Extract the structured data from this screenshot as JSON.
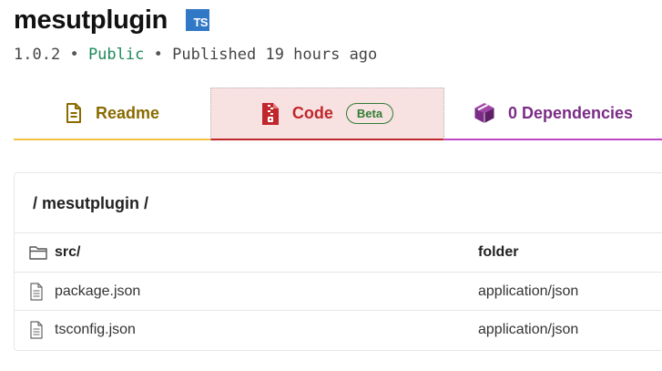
{
  "package": {
    "name": "mesutplugin",
    "ts_badge": "TS",
    "version": "1.0.2",
    "separator": "•",
    "visibility": "Public",
    "published": "Published 19 hours ago"
  },
  "tabs": [
    {
      "label": "Readme",
      "icon": "document-icon",
      "color": "#8a6b00",
      "active": false
    },
    {
      "label": "Code",
      "icon": "zip-file-icon",
      "badge": "Beta",
      "color": "#c0262b",
      "active": true
    },
    {
      "label": "0 Dependencies",
      "icon": "cube-icon",
      "color": "#7b2c86",
      "active": false
    }
  ],
  "files": {
    "breadcrumb": "/ mesutplugin /",
    "rows": [
      {
        "name": "src/",
        "type": "folder",
        "icon": "folder-icon"
      },
      {
        "name": "package.json",
        "type": "application/json",
        "icon": "file-icon"
      },
      {
        "name": "tsconfig.json",
        "type": "application/json",
        "icon": "file-icon"
      }
    ]
  },
  "colors": {
    "ts_blue": "#3178c6",
    "public_green": "#1c8a5c",
    "readme_accent": "#f0c23e",
    "code_accent": "#c0262b",
    "deps_accent": "#c047c3"
  }
}
